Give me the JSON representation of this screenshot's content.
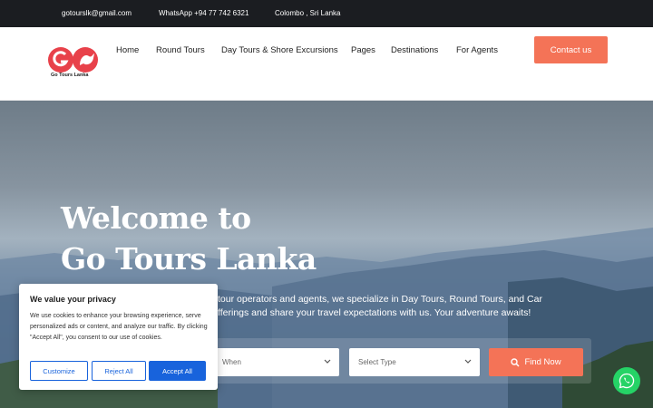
{
  "topbar": {
    "email": "gotourslk@gmail.com",
    "whatsapp": "WhatsApp +94 77 742 6321",
    "location": "Colombo , Sri Lanka"
  },
  "header": {
    "logo_text": "Go Tours Lanka",
    "nav": [
      "Home",
      "Round Tours",
      "Day Tours & Shore Excursions",
      "Pages",
      "Destinations",
      "For Agents"
    ],
    "contact_label": "Contact us"
  },
  "hero": {
    "title_line1": "Welcome to",
    "title_line2": "Go Tours Lanka",
    "text_line1": "tour operators and agents, we specialize in Day Tours, Round Tours, and Car",
    "text_line2": "fferings and share your travel expectations with us. Your adventure awaits!"
  },
  "search": {
    "when_placeholder": "When",
    "type_placeholder": "Select Type",
    "find_label": "Find Now"
  },
  "cookie": {
    "title": "We value your privacy",
    "body": "We use cookies to enhance your browsing experience, serve personalized ads or content, and analyze our traffic. By clicking \"Accept All\", you consent to our use of cookies.",
    "customize_label": "Customize",
    "reject_label": "Reject All",
    "accept_label": "Accept All"
  },
  "colors": {
    "accent": "#f47357",
    "cookie_blue": "#1863dc",
    "topbar_bg": "#1b1d21",
    "whatsapp_green": "#25d366"
  },
  "icons": {
    "search": "search-icon",
    "chevron": "chevron-down-icon",
    "whatsapp": "whatsapp-icon"
  }
}
